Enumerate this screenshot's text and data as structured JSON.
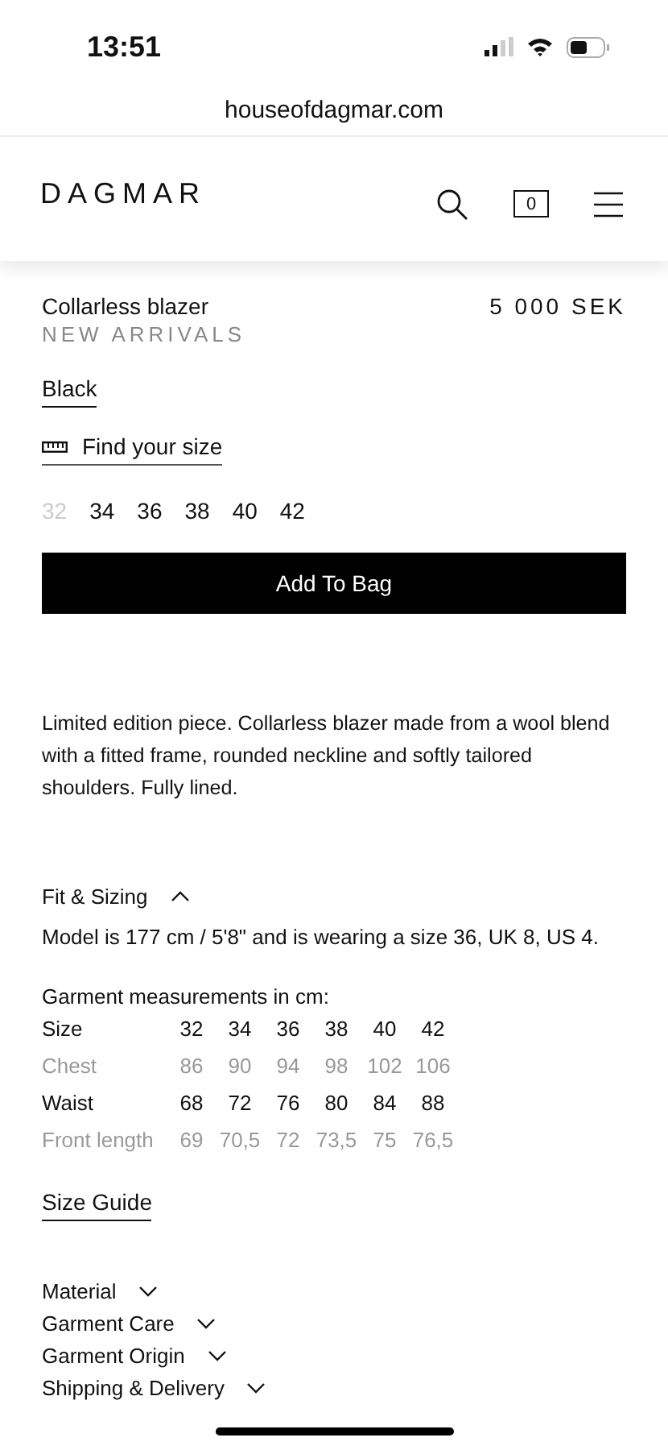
{
  "status_bar": {
    "time": "13:51"
  },
  "browser": {
    "url": "houseofdagmar.com"
  },
  "header": {
    "logo": "DAGMAR",
    "bag_count": "0"
  },
  "product": {
    "name": "Collarless blazer",
    "collection": "NEW ARRIVALS",
    "price": "5 000 SEK",
    "color_option": "Black",
    "find_size": "Find your size",
    "sizes": [
      {
        "label": "32",
        "available": false
      },
      {
        "label": "34",
        "available": true
      },
      {
        "label": "36",
        "available": true
      },
      {
        "label": "38",
        "available": true
      },
      {
        "label": "40",
        "available": true
      },
      {
        "label": "42",
        "available": true
      }
    ],
    "add_button": "Add To Bag",
    "description": "Limited edition piece. Collarless blazer made from a wool blend with a fitted frame, rounded neckline and softly tailored shoulders. Fully lined."
  },
  "fit_sizing": {
    "title": "Fit & Sizing",
    "expanded": true,
    "model_note": "Model is 177 cm / 5'8\" and is wearing a size 36, UK 8, US 4.",
    "table_title": "Garment measurements in cm:",
    "rows": [
      {
        "label": "Size",
        "muted": false,
        "values": [
          "32",
          "34",
          "36",
          "38",
          "40",
          "42"
        ]
      },
      {
        "label": "Chest",
        "muted": true,
        "values": [
          "86",
          "90",
          "94",
          "98",
          "102",
          "106"
        ]
      },
      {
        "label": "Waist",
        "muted": false,
        "values": [
          "68",
          "72",
          "76",
          "80",
          "84",
          "88"
        ]
      },
      {
        "label": "Front length",
        "muted": true,
        "values": [
          "69",
          "70,5",
          "72",
          "73,5",
          "75",
          "76,5"
        ]
      }
    ],
    "size_guide": "Size Guide"
  },
  "accordions": [
    {
      "title": "Material",
      "expanded": false
    },
    {
      "title": "Garment Care",
      "expanded": false
    },
    {
      "title": "Garment Origin",
      "expanded": false
    },
    {
      "title": "Shipping & Delivery",
      "expanded": false
    }
  ]
}
